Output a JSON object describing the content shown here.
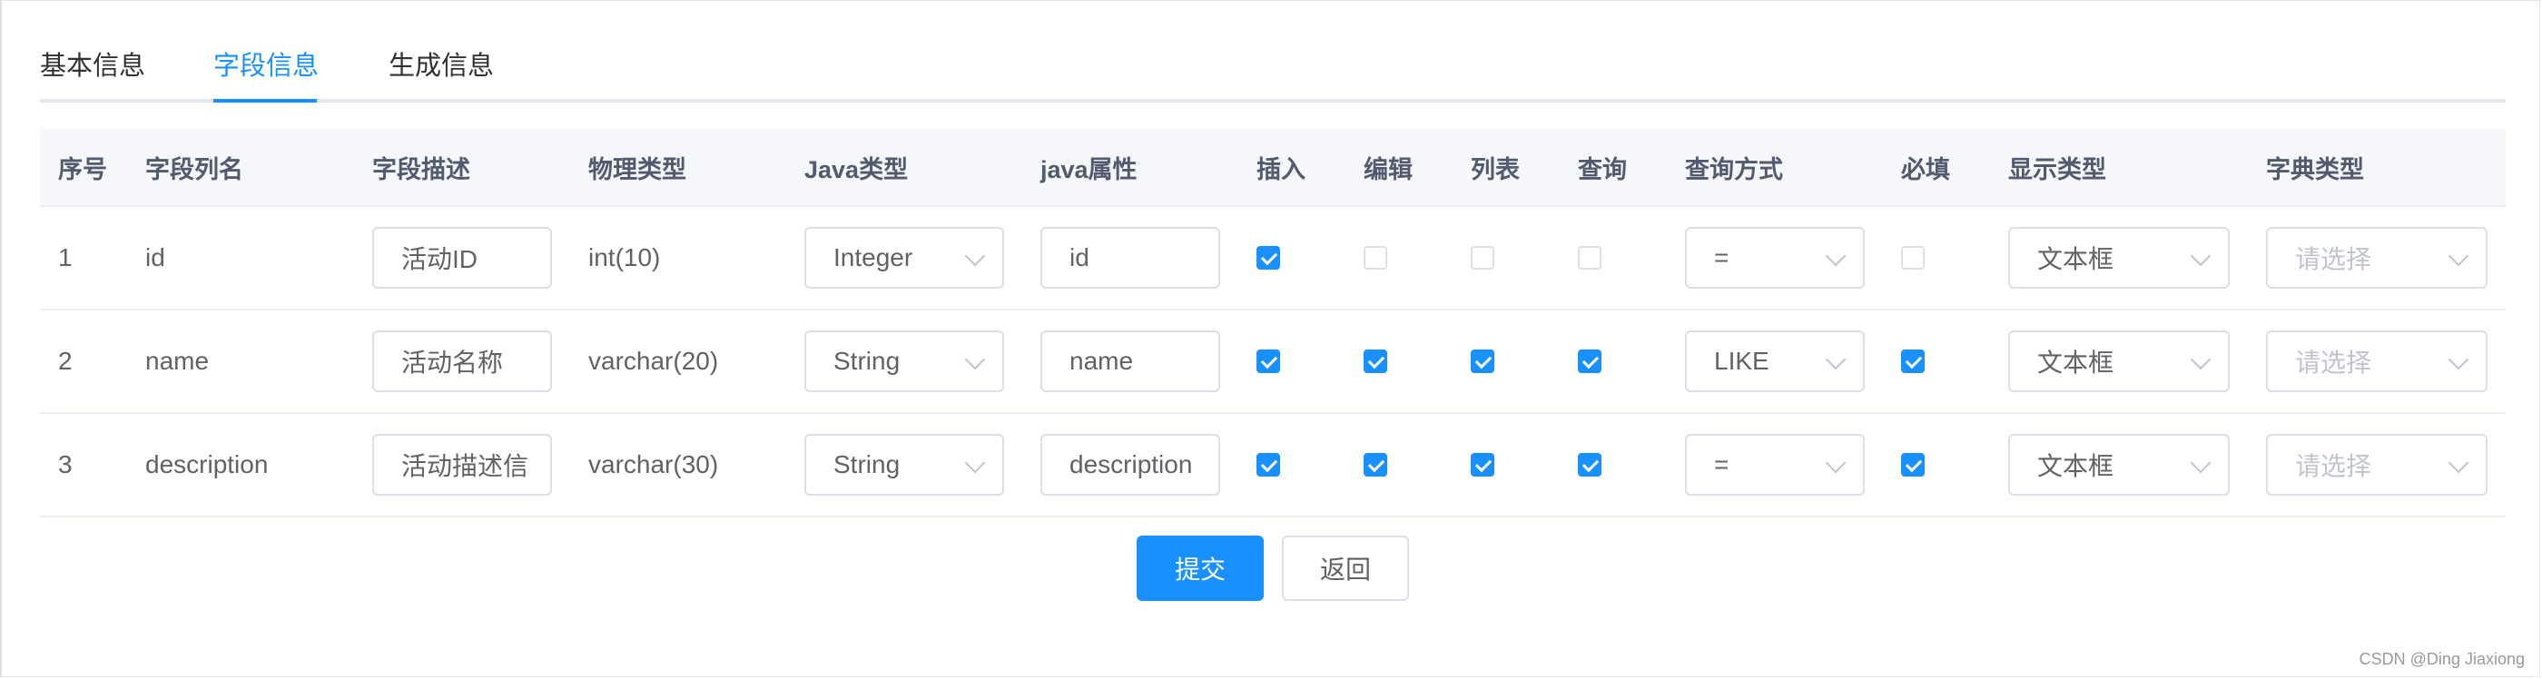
{
  "tabs": [
    {
      "label": "基本信息",
      "active": false
    },
    {
      "label": "字段信息",
      "active": true
    },
    {
      "label": "生成信息",
      "active": false
    }
  ],
  "table": {
    "headers": [
      "序号",
      "字段列名",
      "字段描述",
      "物理类型",
      "Java类型",
      "java属性",
      "插入",
      "编辑",
      "列表",
      "查询",
      "查询方式",
      "必填",
      "显示类型",
      "字典类型"
    ],
    "rows": [
      {
        "index": "1",
        "column": "id",
        "desc": "活动ID",
        "physical": "int(10)",
        "javaType": "Integer",
        "javaField": "id",
        "insert": true,
        "edit": false,
        "list": false,
        "query": false,
        "queryType": "=",
        "required": false,
        "displayType": "文本框",
        "dictPlaceholder": "请选择"
      },
      {
        "index": "2",
        "column": "name",
        "desc": "活动名称",
        "physical": "varchar(20)",
        "javaType": "String",
        "javaField": "name",
        "insert": true,
        "edit": true,
        "list": true,
        "query": true,
        "queryType": "LIKE",
        "required": true,
        "displayType": "文本框",
        "dictPlaceholder": "请选择"
      },
      {
        "index": "3",
        "column": "description",
        "desc": "活动描述信",
        "physical": "varchar(30)",
        "javaType": "String",
        "javaField": "description",
        "insert": true,
        "edit": true,
        "list": true,
        "query": true,
        "queryType": "=",
        "required": true,
        "displayType": "文本框",
        "dictPlaceholder": "请选择"
      }
    ]
  },
  "buttons": {
    "submit": "提交",
    "back": "返回"
  },
  "watermark": "CSDN @Ding Jiaxiong",
  "colors": {
    "primary": "#1890ff",
    "border": "#dcdfe6",
    "headerBg": "#f5f7fa"
  }
}
